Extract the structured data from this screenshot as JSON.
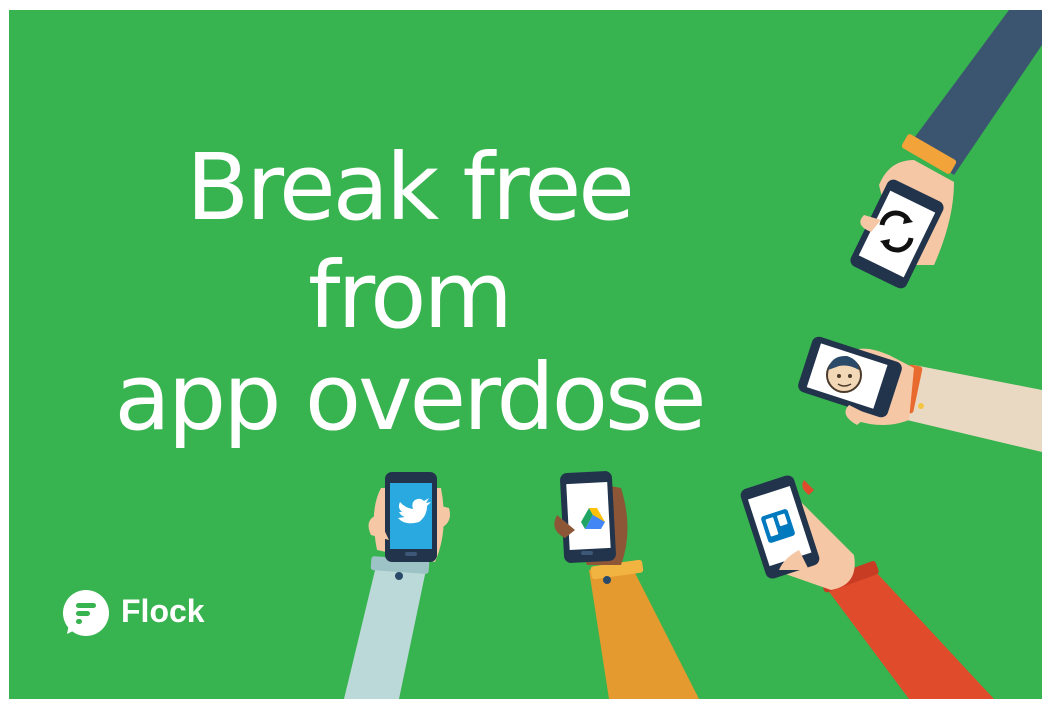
{
  "headline": {
    "line1": "Break free",
    "line2": "from",
    "line3": "app overdose"
  },
  "brand": {
    "name": "Flock",
    "background_color": "#37b34f",
    "text_color": "#ffffff"
  },
  "phones": [
    {
      "app": "twitter",
      "icon": "twitter-bird-icon"
    },
    {
      "app": "google-drive",
      "icon": "google-drive-icon"
    },
    {
      "app": "trello",
      "icon": "trello-icon"
    },
    {
      "app": "mailchimp",
      "icon": "mailchimp-icon"
    },
    {
      "app": "circular-app",
      "icon": "circular-arrows-icon"
    }
  ]
}
